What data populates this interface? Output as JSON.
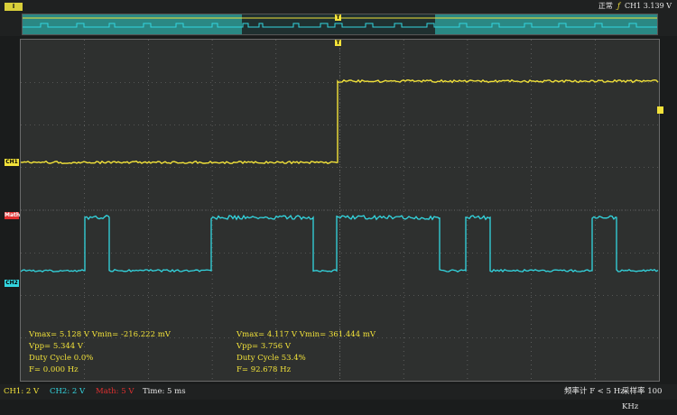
{
  "top": {
    "badge": "Ⅰ",
    "status": "正常",
    "trigger_icon": "ƒ",
    "trigger_value": "CH1 3.139 V"
  },
  "colors": {
    "ch1": "#f2e23a",
    "ch2": "#33d6e0",
    "math": "#e03030",
    "grid": "#7a7a7a"
  },
  "markers": {
    "ch1": "CH1",
    "math": "Math",
    "ch2": "CH2"
  },
  "measurements": {
    "ch1": [
      "Vmax= 5.128 V  Vmin= -216.222 mV",
      "Vpp= 5.344 V",
      "Duty Cycle 0.0%",
      "F= 0.000 Hz"
    ],
    "ch2": [
      "Vmax= 4.117 V  Vmin= 361.444 mV",
      "Vpp= 3.756 V",
      "Duty Cycle 53.4%",
      "F= 92.678 Hz"
    ]
  },
  "bottom": {
    "ch1": "CH1: 2 V",
    "ch2": "CH2: 2 V",
    "math": "Math: 5 V",
    "time": "Time: 5 ms",
    "freq": "频率计 F < 5 Hz",
    "sample": "采样率 100 KHz"
  }
}
